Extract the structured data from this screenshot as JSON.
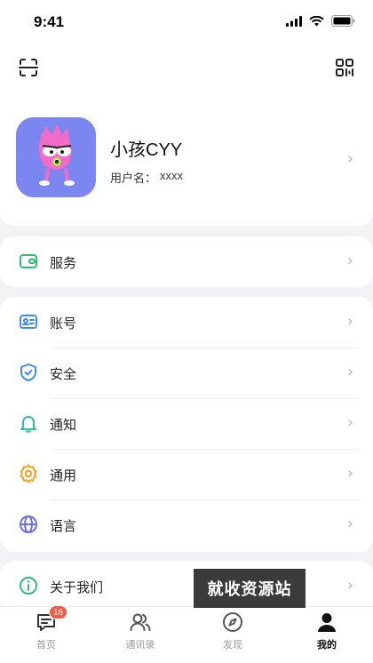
{
  "status_bar": {
    "time": "9:41"
  },
  "profile": {
    "name": "小孩CYY",
    "username_label": "用户名：",
    "username_value": "xxxx"
  },
  "menu": {
    "service": {
      "label": "服务",
      "icon": "wallet-icon",
      "color": "#2fbf71"
    },
    "account": {
      "label": "账号",
      "icon": "id-card-icon",
      "color": "#3d8ef0"
    },
    "security": {
      "label": "安全",
      "icon": "shield-icon",
      "color": "#3d8ef0"
    },
    "notification": {
      "label": "通知",
      "icon": "bell-icon",
      "color": "#2fbfa5"
    },
    "general": {
      "label": "通用",
      "icon": "gear-icon",
      "color": "#f5a023"
    },
    "language": {
      "label": "语言",
      "icon": "globe-icon",
      "color": "#6b6fe0"
    },
    "about": {
      "label": "关于我们",
      "icon": "info-icon",
      "color": "#2fbf71"
    }
  },
  "tabbar": {
    "tabs": [
      {
        "label": "首页",
        "icon": "chat-icon",
        "badge": "16"
      },
      {
        "label": "通讯录",
        "icon": "contacts-icon"
      },
      {
        "label": "发现",
        "icon": "compass-icon"
      },
      {
        "label": "我的",
        "icon": "person-icon",
        "active": true
      }
    ]
  },
  "watermark": {
    "text": "就收资源站"
  }
}
